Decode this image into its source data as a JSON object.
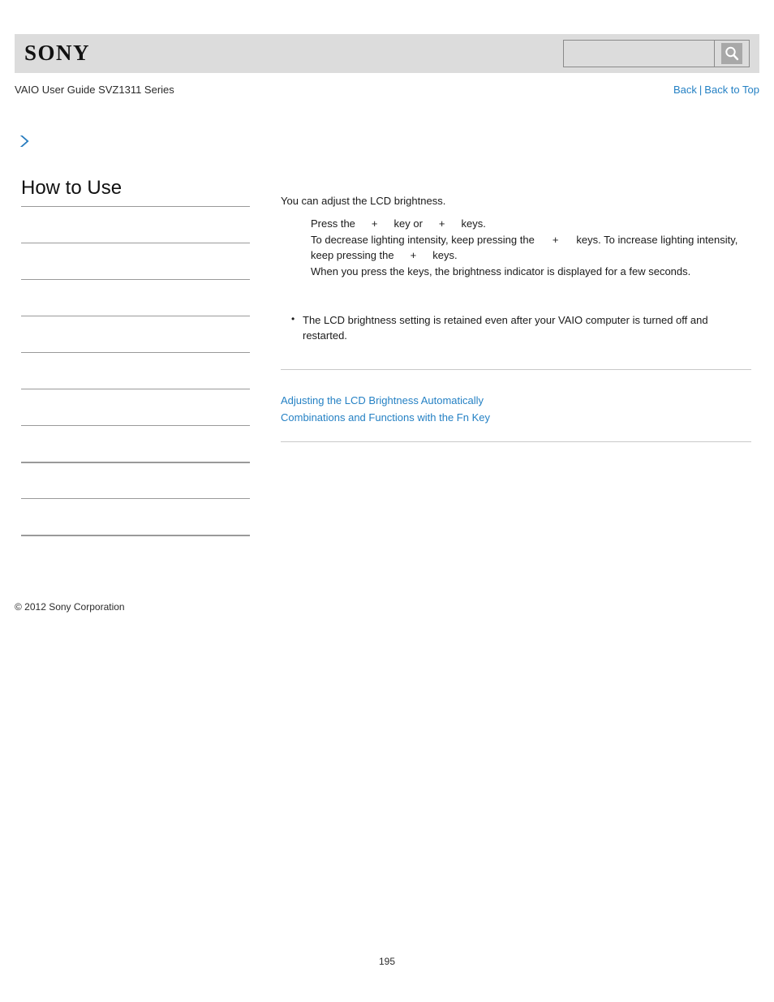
{
  "header": {
    "logo_text": "SONY",
    "search": {
      "value": "",
      "placeholder": "",
      "button_icon": "search-icon"
    }
  },
  "subheader": {
    "guide_title": "VAIO User Guide SVZ1311 Series",
    "back_label": "Back",
    "separator": "|",
    "back_to_top_label": "Back to Top"
  },
  "breadcrumb": {
    "icon": "chevron-right-icon",
    "text": ""
  },
  "sidebar": {
    "title": "How to Use",
    "items": [
      {
        "label": ""
      },
      {
        "label": ""
      },
      {
        "label": ""
      },
      {
        "label": ""
      },
      {
        "label": ""
      },
      {
        "label": ""
      },
      {
        "label": ""
      },
      {
        "label": ""
      },
      {
        "label": ""
      },
      {
        "label": ""
      }
    ]
  },
  "main": {
    "intro": "You can adjust the LCD brightness.",
    "steps": [
      {
        "before": "Press the",
        "mid": "key or",
        "after": "keys."
      },
      {
        "before": "To decrease lighting intensity, keep pressing the",
        "mid": "keys. To increase lighting intensity, keep pressing the",
        "after": "keys."
      },
      {
        "text": "When you press the keys, the brightness indicator is displayed for a few seconds."
      }
    ],
    "notes": [
      "The LCD brightness setting is retained even after your VAIO computer is turned off and restarted."
    ],
    "related_links": [
      "Adjusting the LCD Brightness Automatically",
      "Combinations and Functions with the Fn Key"
    ]
  },
  "footer": {
    "copyright": "© 2012 Sony Corporation",
    "page_number": "195"
  },
  "colors": {
    "link": "#2581c4",
    "header_bar": "#dcdcdc",
    "rule": "#9a9a9a",
    "content_rule": "#c9c9c9"
  }
}
